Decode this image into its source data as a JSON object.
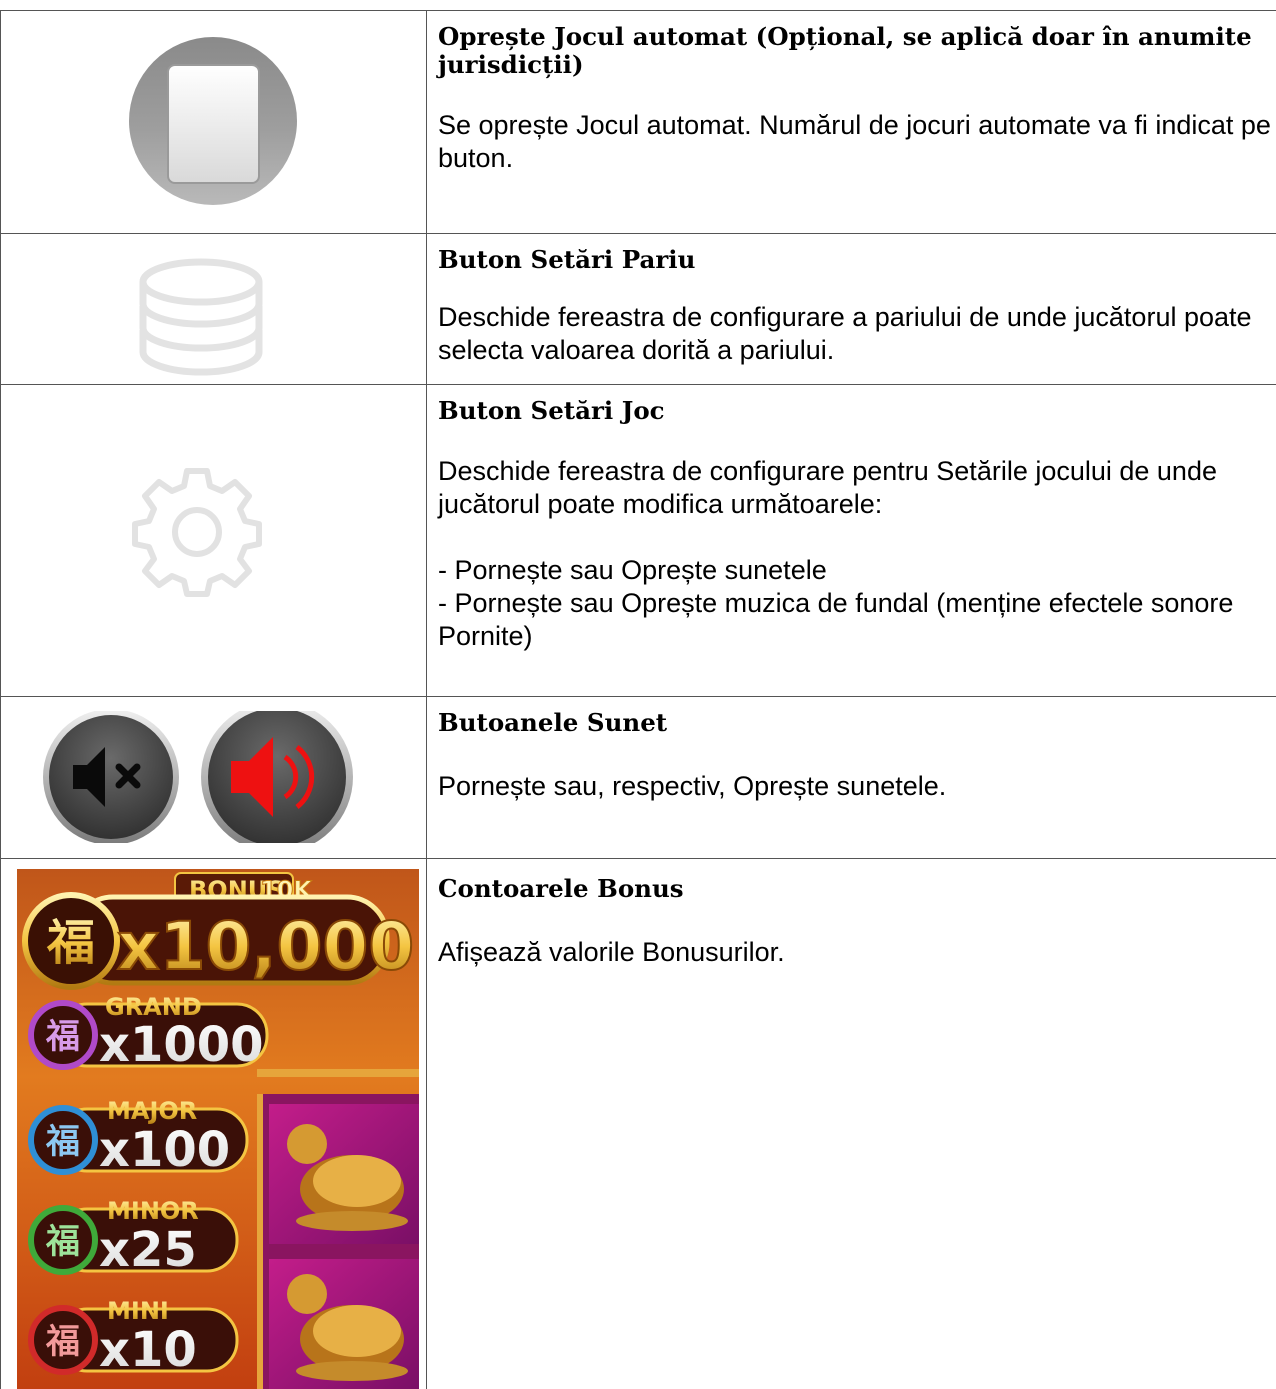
{
  "rows": [
    {
      "icon": "stop-autoplay-icon",
      "title": "Oprește Jocul automat (Opțional, se aplică doar în anumite jurisdicții)",
      "body": "Se oprește Jocul automat. Numărul de jocuri automate va fi indicat pe buton."
    },
    {
      "icon": "coin-stack-icon",
      "title": "Buton Setări Pariu",
      "body": "Deschide fereastra de configurare a pariului de unde jucătorul poate selecta valoarea dorită a pariului."
    },
    {
      "icon": "gear-icon",
      "title": "Buton Setări Joc",
      "body": "Deschide fereastra de configurare pentru Setările jocului de unde jucătorul poate modifica următoarele:",
      "list": [
        "- Pornește sau Oprește sunetele",
        "- Pornește sau Oprește muzica de fundal (menține efectele sonore Pornite)"
      ]
    },
    {
      "icon": "sound-buttons-icon",
      "title": "Butoanele Sunet",
      "body": "Pornește sau, respectiv, Oprește sunetele."
    },
    {
      "icon": "bonus-counters-image",
      "title": "Contoarele Bonus",
      "body": "Afișează valorile Bonusurilor."
    }
  ],
  "bonus_image": {
    "banner": "BONUS",
    "banner_suffix": "10K",
    "top_value": "x10,000",
    "tiers": [
      {
        "name": "GRAND",
        "value": "x1000",
        "color": "#b04ac9"
      },
      {
        "name": "MAJOR",
        "value": "x100",
        "color": "#2f8fd6"
      },
      {
        "name": "MINOR",
        "value": "x25",
        "color": "#3faa3a"
      },
      {
        "name": "MINI",
        "value": "x10",
        "color": "#d12a2a"
      }
    ],
    "glyph": "福"
  }
}
